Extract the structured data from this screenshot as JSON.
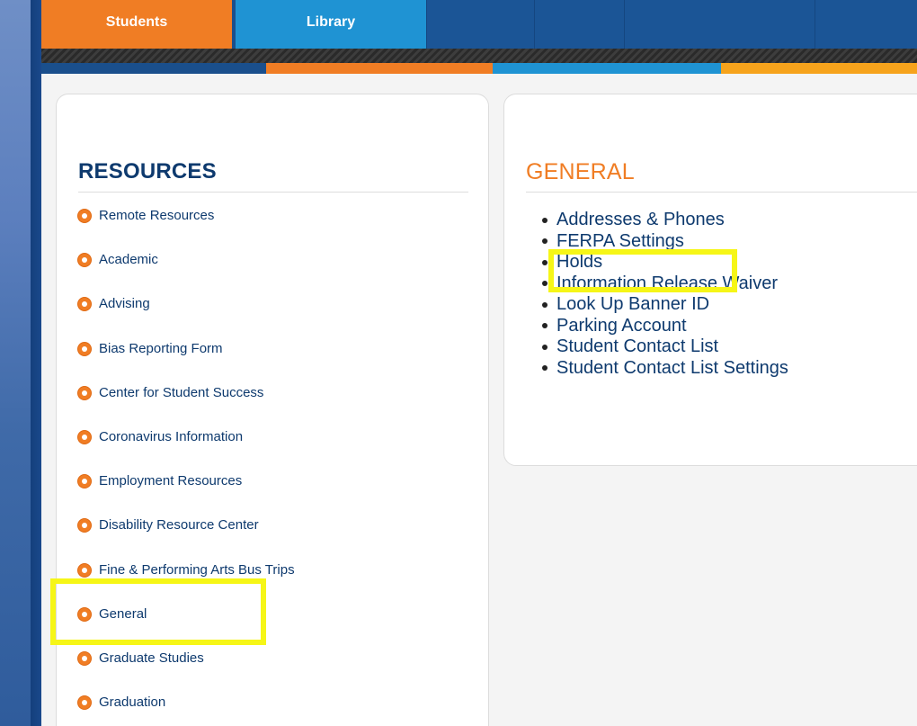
{
  "nav": {
    "tabs": [
      {
        "label": "Students",
        "color": "#f07d24"
      },
      {
        "label": "Library",
        "color": "#1f93d3"
      }
    ]
  },
  "resources": {
    "title": "RESOURCES",
    "icon": "gear-icon",
    "items": [
      {
        "label": "Remote Resources"
      },
      {
        "label": "Academic"
      },
      {
        "label": "Advising"
      },
      {
        "label": "Bias Reporting Form"
      },
      {
        "label": "Center for Student Success"
      },
      {
        "label": "Coronavirus Information"
      },
      {
        "label": "Employment Resources"
      },
      {
        "label": "Disability Resource Center"
      },
      {
        "label": "Fine & Performing Arts Bus Trips"
      },
      {
        "label": "General"
      },
      {
        "label": "Graduate Studies"
      },
      {
        "label": "Graduation"
      }
    ]
  },
  "general": {
    "title": "GENERAL",
    "items": [
      {
        "label": "Addresses & Phones"
      },
      {
        "label": "FERPA Settings"
      },
      {
        "label": "Holds"
      },
      {
        "label": "Information Release Waiver"
      },
      {
        "label": "Look Up Banner ID"
      },
      {
        "label": "Parking Account"
      },
      {
        "label": "Student Contact List"
      },
      {
        "label": "Student Contact List Settings"
      }
    ]
  },
  "colors": {
    "brand_orange": "#f07d24",
    "brand_blue": "#1f93d3",
    "navy": "#0e3a6e",
    "highlight": "#f6f617"
  }
}
